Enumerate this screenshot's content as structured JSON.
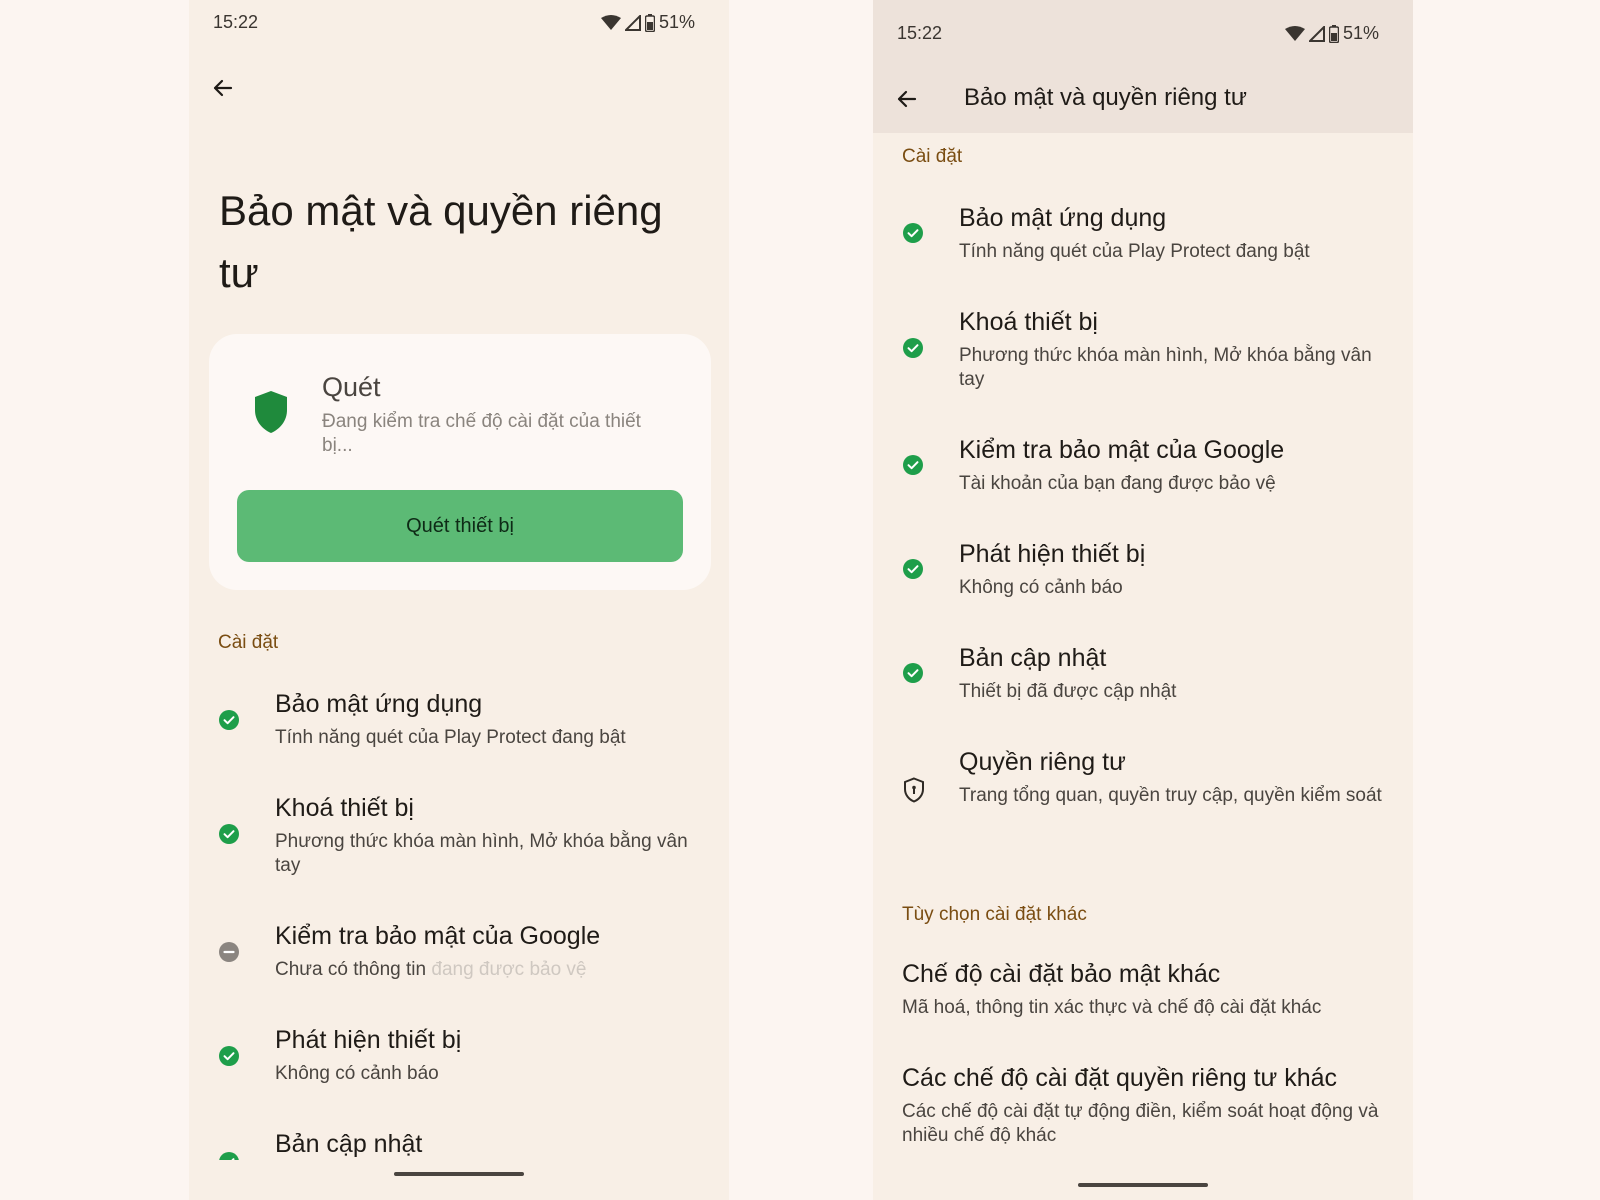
{
  "status": {
    "time": "15:22",
    "battery": "51%"
  },
  "left": {
    "title": "Bảo mật và quyền riêng tư",
    "scan_card": {
      "title": "Quét",
      "subtitle": "Đang kiểm tra chế độ cài đặt của thiết bị...",
      "button_label": "Quét thiết bị",
      "shield_color": "#1f8a3c"
    },
    "section_settings": "Cài đặt",
    "items": [
      {
        "title": "Bảo mật ứng dụng",
        "subtitle": "Tính năng quét của Play Protect đang bật",
        "icon": "check-circle-icon"
      },
      {
        "title": "Khoá thiết bị",
        "subtitle": "Phương thức khóa màn hình, Mở khóa bằng vân tay",
        "icon": "check-circle-icon"
      },
      {
        "title": "Kiểm tra bảo mật của Google",
        "subtitle": "Chưa có thông tin",
        "subtitle_ghost": "đang được bảo vệ",
        "icon": "minus-circle-icon"
      },
      {
        "title": "Phát hiện thiết bị",
        "subtitle": "Không có cảnh báo",
        "icon": "check-circle-icon"
      },
      {
        "title": "Bản cập nhật",
        "icon": "check-circle-icon"
      }
    ]
  },
  "right": {
    "app_bar_title": "Bảo mật và quyền riêng tư",
    "section_settings": "Cài đặt",
    "items": [
      {
        "title": "Bảo mật ứng dụng",
        "subtitle": "Tính năng quét của Play Protect đang bật",
        "icon": "check-circle-icon"
      },
      {
        "title": "Khoá thiết bị",
        "subtitle": "Phương thức khóa màn hình, Mở khóa bằng vân tay",
        "icon": "check-circle-icon"
      },
      {
        "title": "Kiểm tra bảo mật của Google",
        "subtitle": "Tài khoản của bạn đang được bảo vệ",
        "icon": "check-circle-icon"
      },
      {
        "title": "Phát hiện thiết bị",
        "subtitle": "Không có cảnh báo",
        "icon": "check-circle-icon"
      },
      {
        "title": "Bản cập nhật",
        "subtitle": "Thiết bị đã được cập nhật",
        "icon": "check-circle-icon"
      },
      {
        "title": "Quyền riêng tư",
        "subtitle": "Trang tổng quan, quyền truy cập, quyền kiểm soát",
        "icon": "privacy-shield-icon"
      }
    ],
    "section_other": "Tùy chọn cài đặt khác",
    "other_items": [
      {
        "title": "Chế độ cài đặt bảo mật khác",
        "subtitle": "Mã hoá, thông tin xác thực và chế độ cài đặt khác"
      },
      {
        "title": "Các chế độ cài đặt quyền riêng tư khác",
        "subtitle": "Các chế độ cài đặt tự động điền, kiểm soát hoạt động và nhiều chế độ khác"
      }
    ]
  },
  "colors": {
    "accent_green": "#1e9e4a",
    "section_header": "#7a4d12",
    "scan_button": "#5cba75"
  }
}
